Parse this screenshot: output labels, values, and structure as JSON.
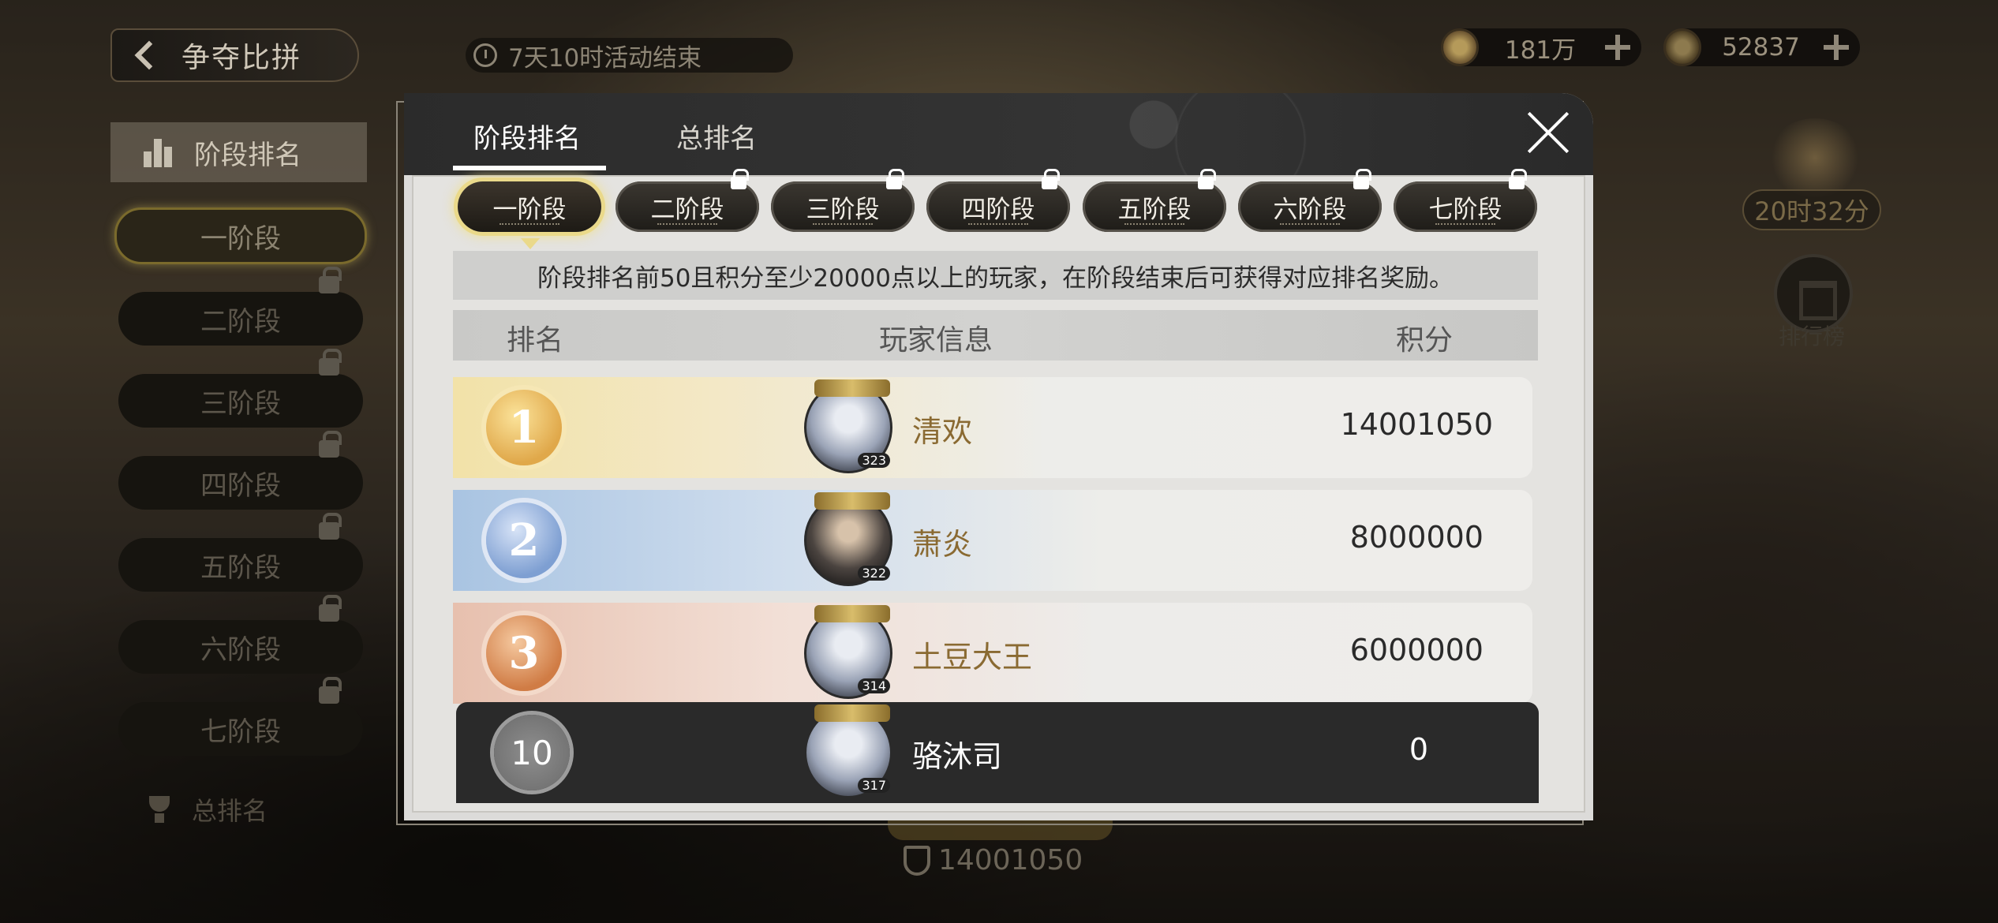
{
  "header": {
    "back_title": "争夺比拼",
    "timer_text": "7天10时活动结束"
  },
  "currency": [
    {
      "icon": "coin-icon",
      "value": "181万"
    },
    {
      "icon": "token-icon",
      "value": "52837"
    }
  ],
  "sidebar": {
    "head_label": "阶段排名",
    "items": [
      {
        "label": "一阶段",
        "locked": false,
        "active": true
      },
      {
        "label": "二阶段",
        "locked": true
      },
      {
        "label": "三阶段",
        "locked": true
      },
      {
        "label": "四阶段",
        "locked": true
      },
      {
        "label": "五阶段",
        "locked": true
      },
      {
        "label": "六阶段",
        "locked": true
      },
      {
        "label": "七阶段",
        "locked": true
      }
    ],
    "total_label": "总排名"
  },
  "right_panel": {
    "chest_timer": "20时32分",
    "rank_label": "排行榜"
  },
  "bottom": {
    "score": "14001050"
  },
  "modal": {
    "tabs": [
      {
        "label": "阶段排名",
        "active": true
      },
      {
        "label": "总排名",
        "active": false
      }
    ],
    "stage_tabs": [
      {
        "label": "一阶段",
        "active": true,
        "locked": false
      },
      {
        "label": "二阶段",
        "locked": true
      },
      {
        "label": "三阶段",
        "locked": true
      },
      {
        "label": "四阶段",
        "locked": true
      },
      {
        "label": "五阶段",
        "locked": true
      },
      {
        "label": "六阶段",
        "locked": true
      },
      {
        "label": "七阶段",
        "locked": true
      }
    ],
    "notice": "阶段排名前50且积分至少20000点以上的玩家，在阶段结束后可获得对应排名奖励。",
    "columns": [
      "排名",
      "玩家信息",
      "积分"
    ],
    "rows": [
      {
        "rank": "1",
        "name": "清欢",
        "score": "14001050",
        "level": "323"
      },
      {
        "rank": "2",
        "name": "萧炎",
        "score": "8000000",
        "level": "322"
      },
      {
        "rank": "3",
        "name": "土豆大王",
        "score": "6000000",
        "level": "314"
      }
    ],
    "self_row": {
      "rank": "10",
      "name": "骆沐司",
      "score": "0",
      "level": "317"
    }
  }
}
